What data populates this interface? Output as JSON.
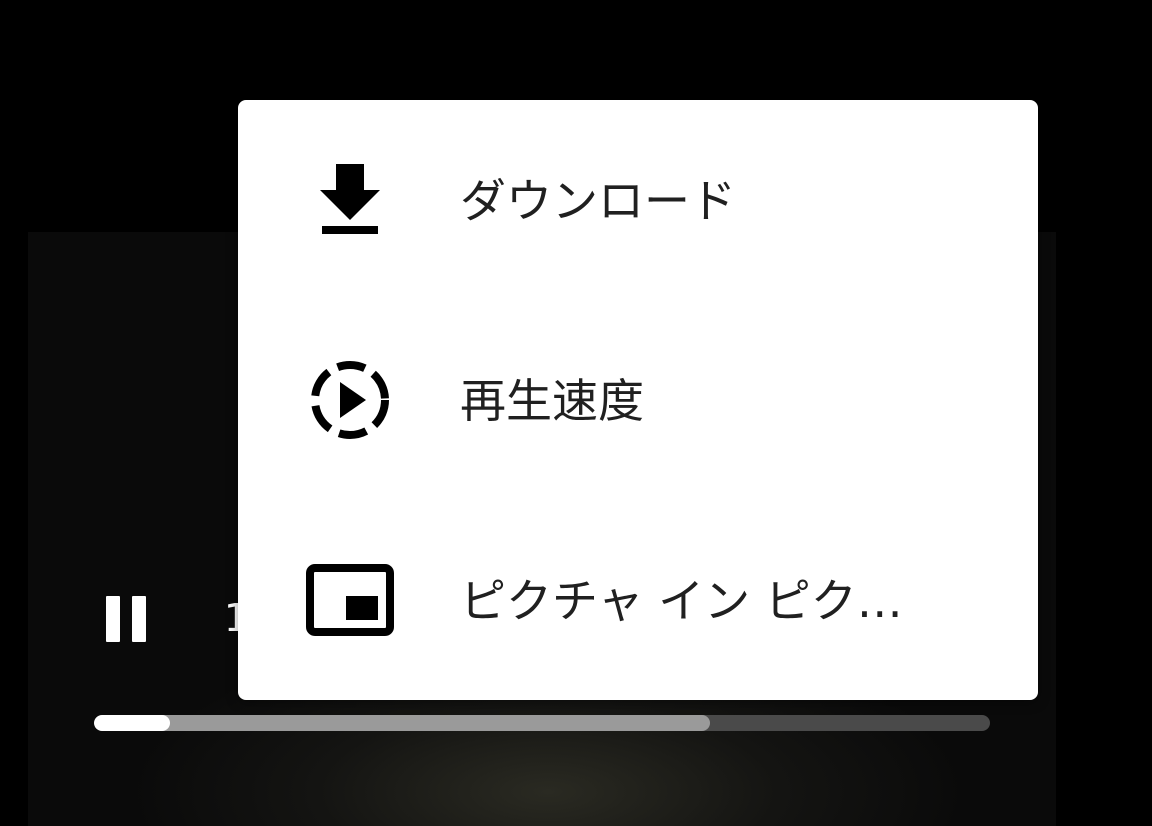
{
  "player": {
    "time_display": "1",
    "progress": {
      "played_fraction": 0.085,
      "buffered_fraction": 0.688
    }
  },
  "menu": {
    "items": [
      {
        "label": "ダウンロード",
        "icon": "download-icon"
      },
      {
        "label": "再生速度",
        "icon": "playback-speed-icon"
      },
      {
        "label": "ピクチャ イン ピク…",
        "icon": "picture-in-picture-icon"
      }
    ]
  },
  "colors": {
    "menu_background": "#ffffff",
    "menu_text": "#202020",
    "progress_played": "#ffffff",
    "progress_buffered": "#9a9a9a",
    "progress_track": "#4a4a4a"
  }
}
